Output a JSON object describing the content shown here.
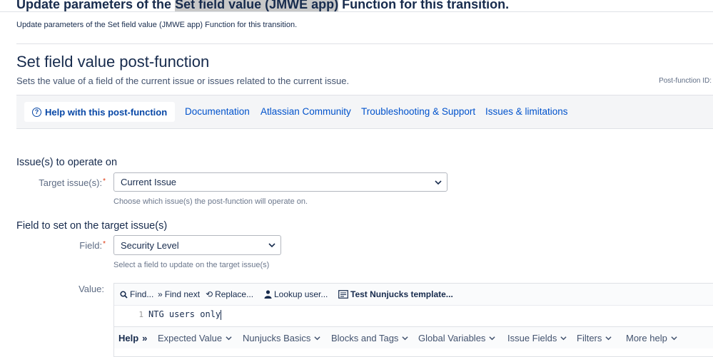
{
  "heading": {
    "prefix": "Update parameters of the ",
    "highlight": "Set field value (JMWE app)",
    "suffix": " Function for this transition."
  },
  "description": "Update parameters of the Set field value (JMWE app) Function for this transition.",
  "postfunction": {
    "title": "Set field value post-function",
    "subtitle": "Sets the value of a field of the current issue or issues related to the current issue.",
    "id_label": "Post-function ID:"
  },
  "help_bar": {
    "help_button": "Help with this post-function",
    "links": [
      "Documentation",
      "Atlassian Community",
      "Troubleshooting & Support",
      "Issues & limitations"
    ]
  },
  "sections": {
    "issues": {
      "heading": "Issue(s) to operate on",
      "label": "Target issue(s):",
      "required_mark": "*",
      "value": "Current Issue",
      "hint": "Choose which issue(s) the post-function will operate on."
    },
    "field": {
      "heading": "Field to set on the target issue(s)",
      "label": "Field:",
      "required_mark": "*",
      "value": "Security Level",
      "hint": "Select a field to update on the target issue(s)"
    }
  },
  "value": {
    "label": "Value:",
    "toolbar": {
      "find": "Find...",
      "find_next": "Find next",
      "replace": "Replace...",
      "lookup_user": "Lookup user...",
      "test_template": "Test Nunjucks template..."
    },
    "line_number": "1",
    "code": "NTG users only"
  },
  "help_menu": {
    "label": "Help",
    "items": [
      "Expected Value",
      "Nunjucks Basics",
      "Blocks and Tags",
      "Global Variables",
      "Issue Fields",
      "Filters",
      "More help"
    ]
  },
  "colors": {
    "link": "#0052cc",
    "required": "#de350b",
    "highlight": "#c8c8c8"
  }
}
